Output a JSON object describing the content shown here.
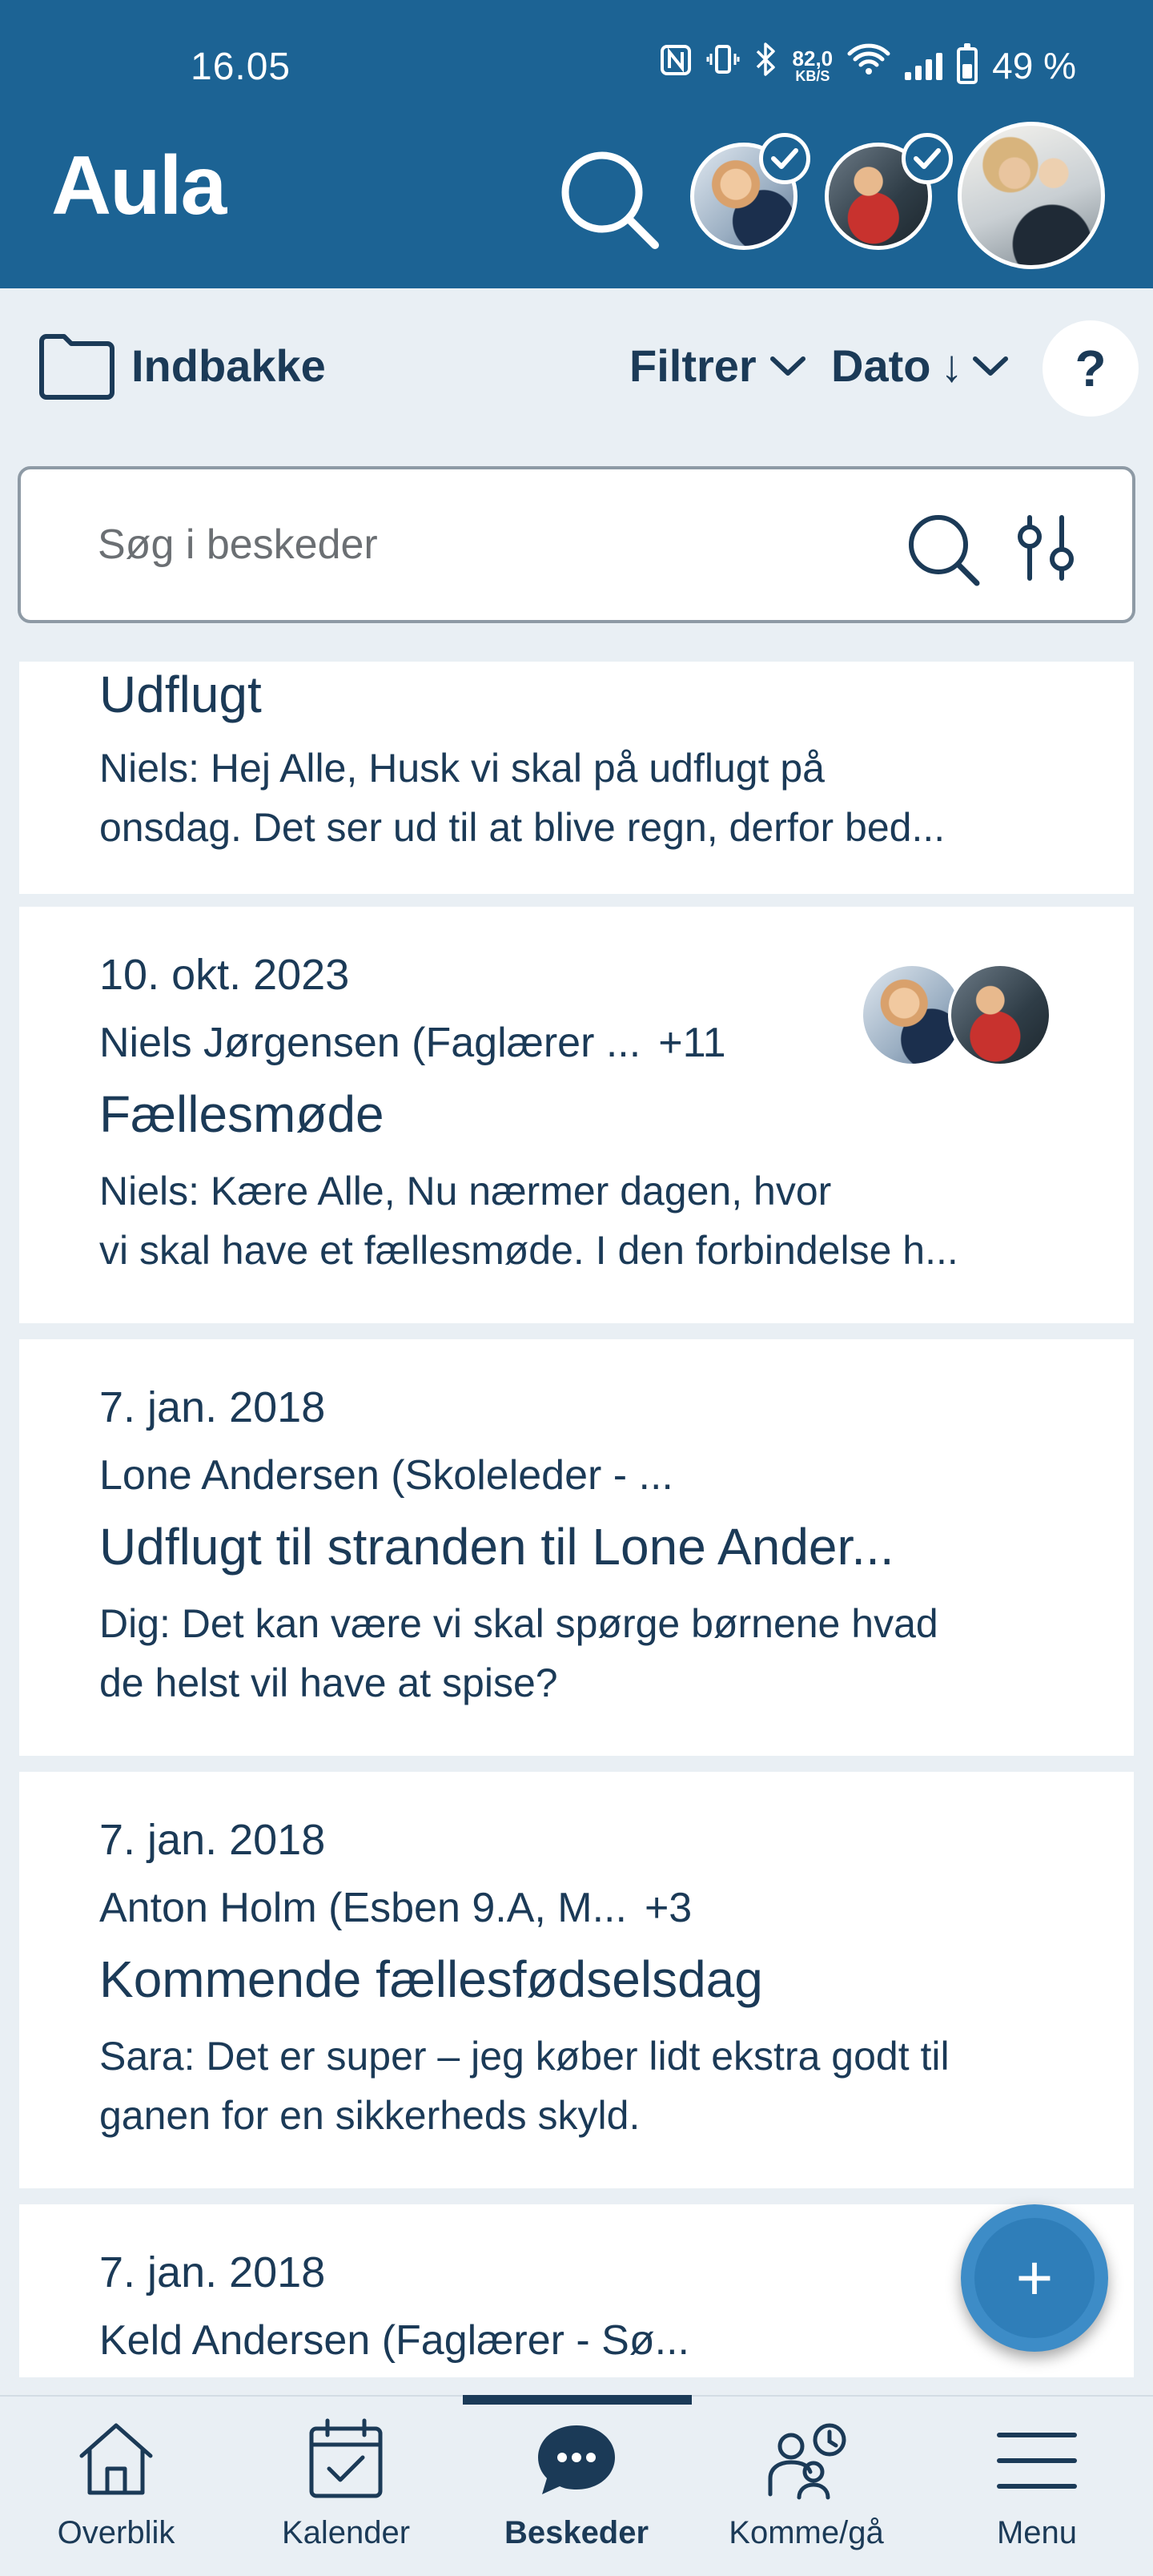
{
  "status_bar": {
    "time": "16.05",
    "speed_value": "82,0",
    "speed_unit": "KB/S",
    "battery": "49 %"
  },
  "header": {
    "logo": "Aula"
  },
  "toolbar": {
    "folder_label": "Indbakke",
    "filter_label": "Filtrer",
    "sort_label": "Dato",
    "sort_arrow": "↓",
    "help_label": "?"
  },
  "search": {
    "placeholder": "Søg i beskeder"
  },
  "messages": [
    {
      "subject": "Udflugt",
      "preview_lines": [
        "Niels: Hej Alle,    Husk vi skal på udflugt på",
        "onsdag. Det ser ud til at blive regn, derfor bed..."
      ]
    },
    {
      "date": "10. okt. 2023",
      "sender": "Niels Jørgensen (Faglærer ...",
      "extra": "+11",
      "subject": "Fællesmøde",
      "preview_lines": [
        "Niels: Kære Alle,    Nu nærmer dagen, hvor",
        "vi skal have et fællesmøde. I den forbindelse h..."
      ]
    },
    {
      "date": "7. jan. 2018",
      "sender": "Lone Andersen (Skoleleder - ...",
      "subject": "Udflugt til stranden til Lone Ander...",
      "preview_lines": [
        "Dig: Det kan være vi skal spørge børnene hvad",
        "de helst vil have at spise?"
      ]
    },
    {
      "date": "7. jan. 2018",
      "sender": "Anton Holm (Esben 9.A, M...",
      "extra": "+3",
      "subject": "Kommende fællesfødselsdag",
      "preview_lines": [
        "Sara: Det er super – jeg køber lidt ekstra godt til",
        "ganen for en sikkerheds skyld."
      ]
    },
    {
      "date": "7. jan. 2018",
      "sender": "Keld Andersen (Faglærer - Sø..."
    }
  ],
  "fab": {
    "label": "+"
  },
  "nav": {
    "items": [
      {
        "label": "Overblik",
        "icon": "house-icon"
      },
      {
        "label": "Kalender",
        "icon": "calendar-check-icon"
      },
      {
        "label": "Beskeder",
        "icon": "chat-bubble-icon",
        "active": true
      },
      {
        "label": "Komme/gå",
        "icon": "people-clock-icon"
      },
      {
        "label": "Menu",
        "icon": "hamburger-menu-icon"
      }
    ]
  },
  "colors": {
    "header_bg": "#1c6394",
    "page_bg": "#e9eff4",
    "text_dark": "#1b3a57",
    "fab": "#3d8cc7"
  }
}
